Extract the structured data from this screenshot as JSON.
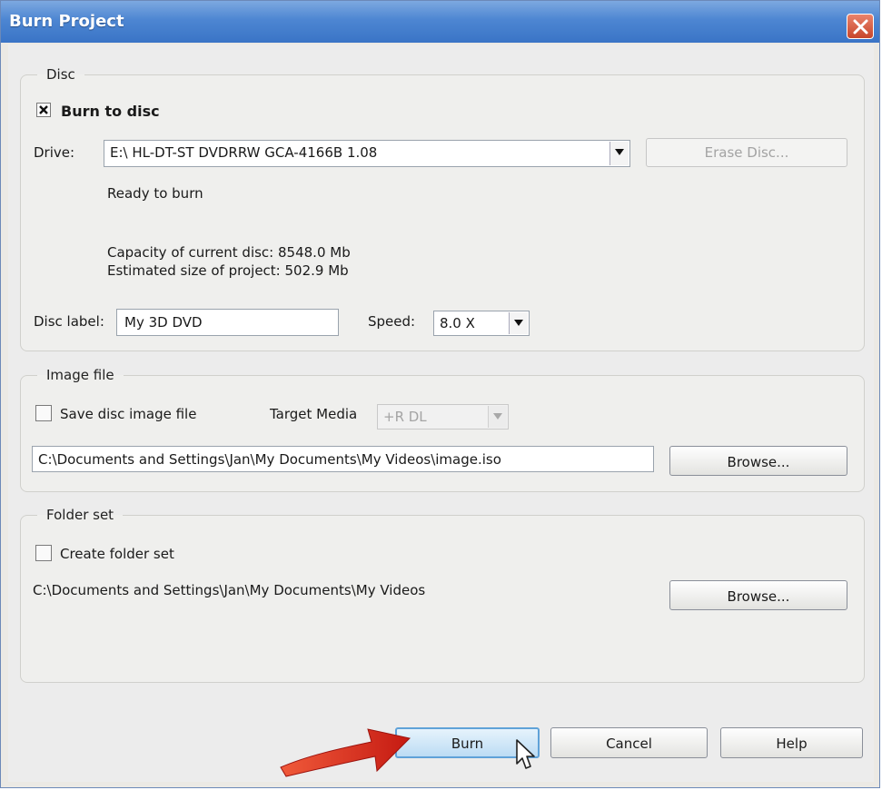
{
  "window": {
    "title": "Burn Project"
  },
  "disc": {
    "legend": "Disc",
    "burn_to_disc": {
      "label": "Burn to disc",
      "checked": true
    },
    "drive_label": "Drive:",
    "drive_value": "E:\\ HL-DT-ST DVDRRW GCA-4166B 1.08",
    "erase_button": "Erase Disc...",
    "status": "Ready to burn",
    "capacity": "Capacity of current disc: 8548.0 Mb",
    "estimated": "Estimated size of project: 502.9 Mb",
    "disc_label_label": "Disc label:",
    "disc_label_value": "My 3D DVD",
    "speed_label": "Speed:",
    "speed_value": "8.0 X"
  },
  "image_file": {
    "legend": "Image file",
    "save_image": {
      "label": "Save disc image file",
      "checked": false
    },
    "target_media_label": "Target Media",
    "target_media_value": "+R DL",
    "path": "C:\\Documents and Settings\\Jan\\My Documents\\My Videos\\image.iso",
    "browse_button": "Browse..."
  },
  "folder_set": {
    "legend": "Folder set",
    "create_folder_set": {
      "label": "Create folder set",
      "checked": false
    },
    "path": "C:\\Documents and Settings\\Jan\\My Documents\\My Videos",
    "browse_button": "Browse..."
  },
  "footer": {
    "burn_button": "Burn",
    "cancel_button": "Cancel",
    "help_button": "Help"
  },
  "colors": {
    "titlebar": "#3a74c6",
    "close_button": "#c8462b",
    "annotation_arrow": "#d8241c"
  }
}
